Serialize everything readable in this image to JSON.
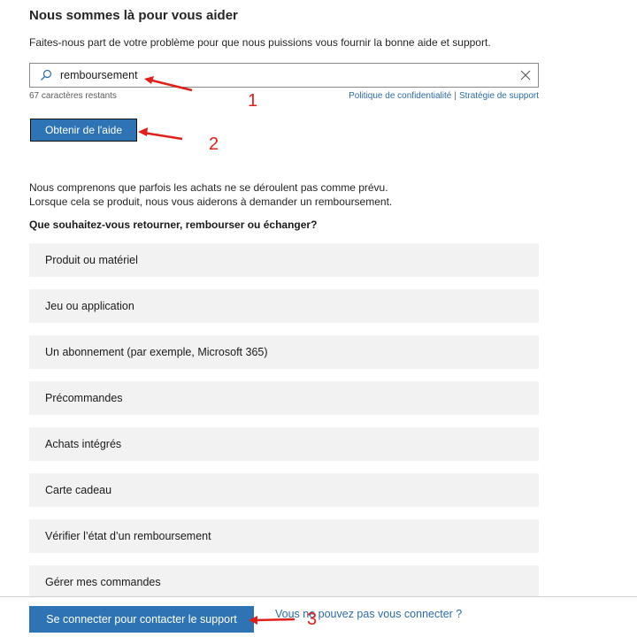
{
  "header": {
    "title": "Nous sommes là pour vous aider",
    "subtitle": "Faites-nous part de votre problème pour que nous puissions vous fournir la bonne aide et support."
  },
  "search": {
    "value": "remboursement",
    "chars_remaining": "67 caractères restants",
    "search_icon": "search-icon",
    "clear_icon": "close-icon"
  },
  "links": {
    "privacy": "Politique de confidentialité",
    "separator": "|",
    "support_strategy": "Stratégie de support"
  },
  "get_help_button": "Obtenir de l'aide",
  "info": {
    "line1": "Nous comprenons que parfois les achats ne se déroulent pas comme prévu.",
    "line2": "Lorsque cela se produit, nous vous aiderons à demander un remboursement.",
    "question": "Que souhaitez-vous retourner, rembourser ou échanger?"
  },
  "options": [
    {
      "label": "Produit ou matériel"
    },
    {
      "label": "Jeu ou application"
    },
    {
      "label": "Un abonnement (par exemple, Microsoft 365)"
    },
    {
      "label": "Précommandes"
    },
    {
      "label": "Achats intégrés"
    },
    {
      "label": "Carte cadeau"
    },
    {
      "label": "Vérifier l’état d’un remboursement"
    },
    {
      "label": "Gérer mes commandes"
    }
  ],
  "footer": {
    "signin_button": "Se connecter pour contacter le support",
    "cant_sign_in": "Vous ne pouvez pas vous connecter ?"
  },
  "annotations": {
    "n1": "1",
    "n2": "2",
    "n3": "3",
    "color": "#e0201a"
  },
  "colors": {
    "primary_button": "#2e74b5",
    "link": "#2d6ca8",
    "option_bg": "#f2f2f2"
  }
}
